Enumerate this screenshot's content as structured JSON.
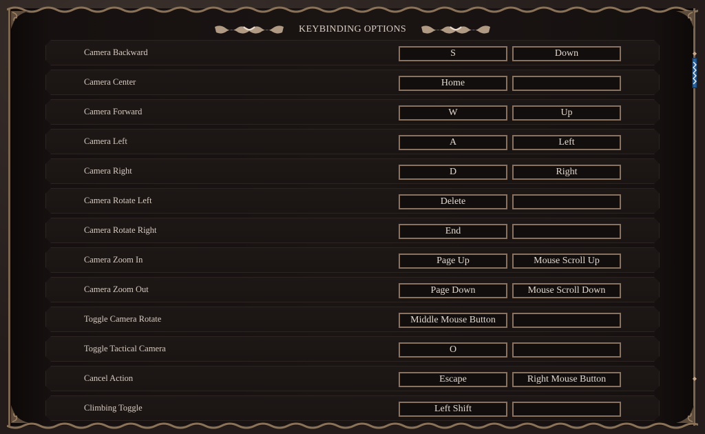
{
  "window": {
    "title": "KEYBINDING OPTIONS"
  },
  "colors": {
    "frame_gold": "#7a6550",
    "key_border": "#8a7260",
    "text": "#d6cbc0",
    "scroll_thumb": "#2e6aa8"
  },
  "icons": {
    "title_left": "ornament-icon",
    "title_right": "ornament-icon",
    "scroll_up": "scroll-up-icon",
    "scroll_down": "scroll-down-icon"
  },
  "scroll": {
    "position_fraction": 0.0
  },
  "bindings": [
    {
      "action": "Camera Backward",
      "primary": "S",
      "secondary": "Down"
    },
    {
      "action": "Camera Center",
      "primary": "Home",
      "secondary": ""
    },
    {
      "action": "Camera Forward",
      "primary": "W",
      "secondary": "Up"
    },
    {
      "action": "Camera Left",
      "primary": "A",
      "secondary": "Left"
    },
    {
      "action": "Camera Right",
      "primary": "D",
      "secondary": "Right"
    },
    {
      "action": "Camera Rotate Left",
      "primary": "Delete",
      "secondary": ""
    },
    {
      "action": "Camera Rotate Right",
      "primary": "End",
      "secondary": ""
    },
    {
      "action": "Camera Zoom In",
      "primary": "Page Up",
      "secondary": "Mouse Scroll Up"
    },
    {
      "action": "Camera Zoom Out",
      "primary": "Page Down",
      "secondary": "Mouse Scroll Down"
    },
    {
      "action": "Toggle Camera Rotate",
      "primary": "Middle Mouse Button",
      "secondary": ""
    },
    {
      "action": "Toggle Tactical Camera",
      "primary": "O",
      "secondary": ""
    },
    {
      "action": "Cancel Action",
      "primary": "Escape",
      "secondary": "Right Mouse Button"
    },
    {
      "action": "Climbing Toggle",
      "primary": "Left Shift",
      "secondary": ""
    }
  ]
}
